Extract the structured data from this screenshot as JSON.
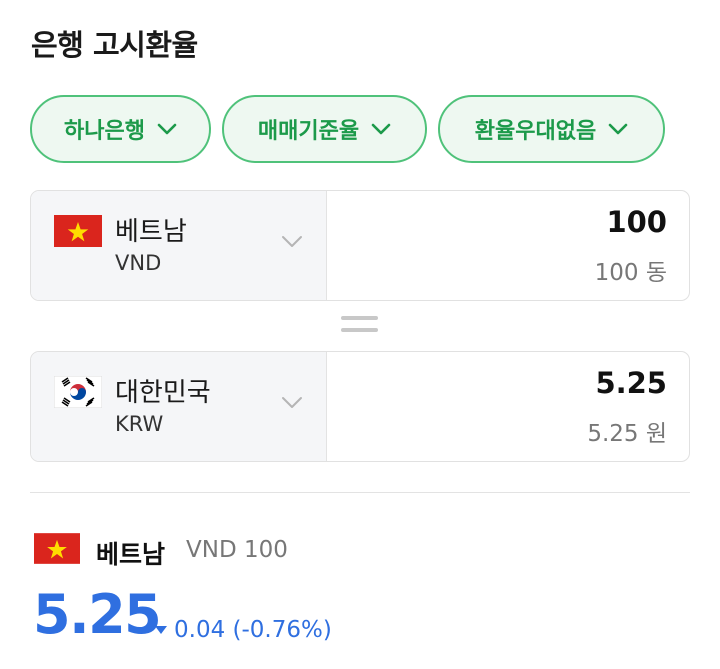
{
  "page": {
    "title": "은행 고시환율"
  },
  "filters": [
    {
      "label": "하나은행"
    },
    {
      "label": "매매기준율"
    },
    {
      "label": "환율우대없음"
    }
  ],
  "from": {
    "country": "베트남",
    "code": "VND",
    "amount": "100",
    "amount_text": "100 동",
    "flag": "vietnam-flag"
  },
  "to": {
    "country": "대한민국",
    "code": "KRW",
    "amount": "5.25",
    "amount_text": "5.25 원",
    "flag": "korea-flag"
  },
  "summary": {
    "country": "베트남",
    "unit": "VND 100",
    "rate": "5.25",
    "change": "0.04 (-0.76%)",
    "direction": "down"
  },
  "colors": {
    "accent_green": "#1c9a4a",
    "chip_border": "#4fc27a",
    "chip_bg": "#eef8f1",
    "rate_blue": "#2f6fe0"
  }
}
